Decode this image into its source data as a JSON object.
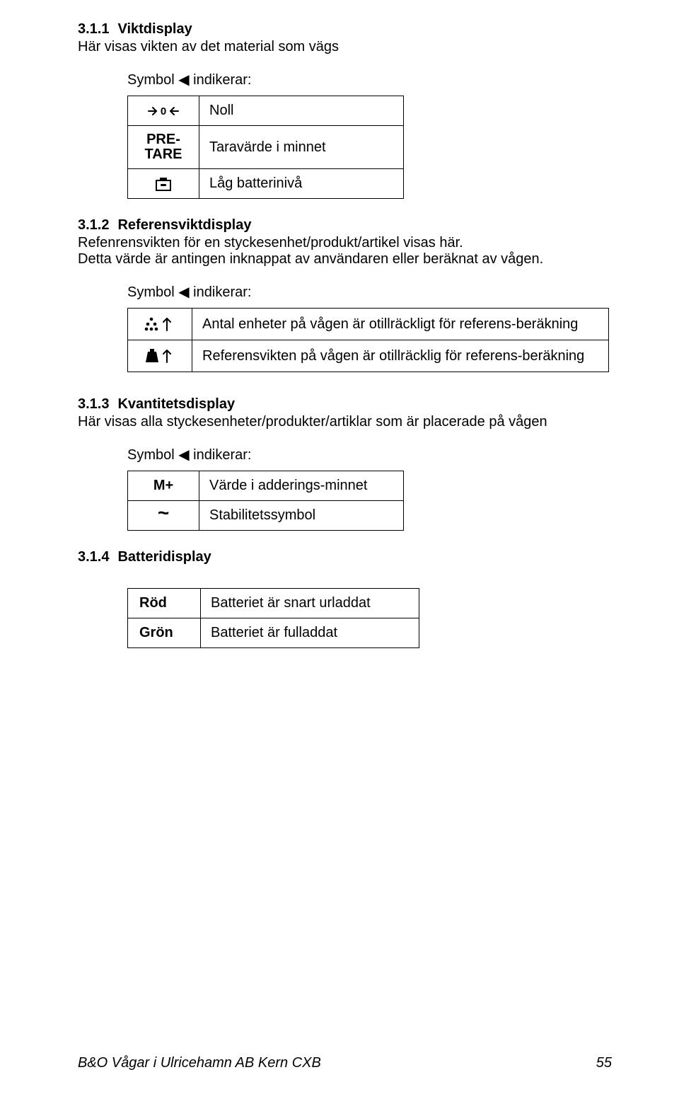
{
  "s1": {
    "num": "3.1.1",
    "title": "Viktdisplay",
    "intro": "Här visas vikten av det material som vägs",
    "symbol_line": "Symbol ◀ indikerar:",
    "rows": {
      "r1": {
        "label": "Noll"
      },
      "r2": {
        "tag1": "PRE-",
        "tag2": "TARE",
        "label": "Taravärde i minnet"
      },
      "r3": {
        "label": "Låg batterinivå"
      }
    }
  },
  "s2": {
    "num": "3.1.2",
    "title": "Referensviktdisplay",
    "intro1": "Refenrensvikten för en styckesenhet/produkt/artikel visas här.",
    "intro2": "Detta värde är antingen inknappat av användaren eller beräknat av vågen.",
    "symbol_line": "Symbol ◀ indikerar:",
    "rows": {
      "r1": {
        "label": "Antal enheter på vågen är otillräckligt för referens-beräkning"
      },
      "r2": {
        "label": "Referensvikten på vågen är otillräcklig för referens-beräkning"
      }
    }
  },
  "s3": {
    "num": "3.1.3",
    "title": "Kvantitetsdisplay",
    "intro": "Här visas alla styckesenheter/produkter/artiklar som är placerade på vågen",
    "symbol_line": "Symbol ◀ indikerar:",
    "rows": {
      "r1": {
        "tag": "M+",
        "label": "Värde i adderings-minnet"
      },
      "r2": {
        "label": "Stabilitetssymbol"
      }
    }
  },
  "s4": {
    "num": "3.1.4",
    "title": "Batteridisplay",
    "rows": {
      "r1": {
        "tag": "Röd",
        "label": "Batteriet är snart urladdat"
      },
      "r2": {
        "tag": "Grön",
        "label": "Batteriet är fulladdat"
      }
    }
  },
  "footer": {
    "left": "B&O Vågar i Ulricehamn AB Kern CXB",
    "right": "55"
  }
}
